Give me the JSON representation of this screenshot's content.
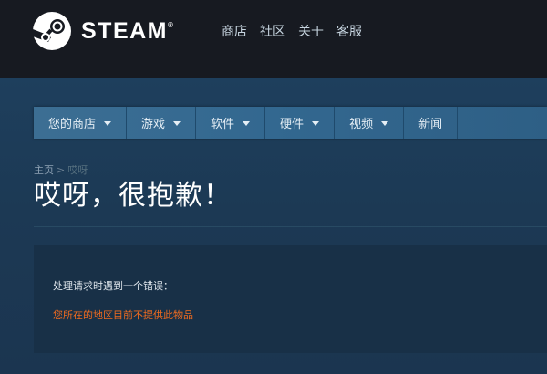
{
  "header": {
    "logo_text": "STEAM",
    "logo_mark": "®",
    "nav": [
      "商店",
      "社区",
      "关于",
      "客服"
    ]
  },
  "menu": {
    "items": [
      {
        "label": "您的商店",
        "dropdown": true
      },
      {
        "label": "游戏",
        "dropdown": true
      },
      {
        "label": "软件",
        "dropdown": true
      },
      {
        "label": "硬件",
        "dropdown": true
      },
      {
        "label": "视频",
        "dropdown": true
      },
      {
        "label": "新闻",
        "dropdown": false
      }
    ]
  },
  "breadcrumb": {
    "home": "主页",
    "separator": ">",
    "current": "哎呀"
  },
  "page": {
    "title": "哎呀，很抱歉！"
  },
  "error": {
    "heading": "处理请求时遇到一个错误：",
    "message": "您所在的地区目前不提供此物品"
  },
  "colors": {
    "topbar": "#171a21",
    "menubar": "#3c6e93",
    "error_text": "#f06b1f"
  }
}
